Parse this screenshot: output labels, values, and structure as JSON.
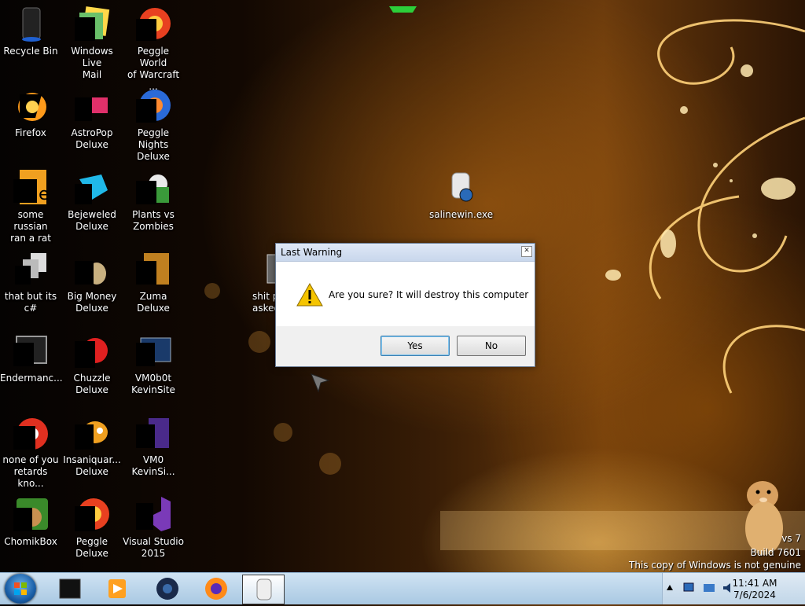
{
  "desktop": {
    "icons": [
      {
        "label": "Recycle Bin",
        "icon": "recycle-bin-icon"
      },
      {
        "label": "Windows Live\nMail",
        "icon": "mail-icon"
      },
      {
        "label": "Peggle World\nof Warcraft ...",
        "icon": "peggle-icon"
      },
      {
        "label": "Firefox",
        "icon": "firefox-icon"
      },
      {
        "label": "AstroPop\nDeluxe",
        "icon": "astropop-icon"
      },
      {
        "label": "Peggle Nights\nDeluxe",
        "icon": "peggle-nights-icon"
      },
      {
        "label": "some russian\nran a rat",
        "icon": "file-icon"
      },
      {
        "label": "Bejeweled\nDeluxe",
        "icon": "bejeweled-icon"
      },
      {
        "label": "Plants vs\nZombies",
        "icon": "plants-vs-zombies-icon"
      },
      {
        "label": "that but its c#",
        "icon": "shortcut-icon"
      },
      {
        "label": "Big Money\nDeluxe",
        "icon": "big-money-icon"
      },
      {
        "label": "Zuma Deluxe",
        "icon": "zuma-icon"
      },
      {
        "label": "Endermanc...",
        "icon": "monitor-icon"
      },
      {
        "label": "Chuzzle\nDeluxe",
        "icon": "chuzzle-icon"
      },
      {
        "label": "VM0b0t\nKevinSite",
        "icon": "vm-icon"
      },
      {
        "label": "none of you\nretards kno...",
        "icon": "chrome-icon"
      },
      {
        "label": "Insaniquar...\nDeluxe",
        "icon": "insaniquarium-icon"
      },
      {
        "label": "VM0\nKevinSi...",
        "icon": "vm-file-icon"
      },
      {
        "label": "ChomikBox",
        "icon": "chomikbox-icon"
      },
      {
        "label": "Peggle Deluxe",
        "icon": "peggle-deluxe-icon"
      },
      {
        "label": "Visual Studio\n2015",
        "icon": "visual-studio-icon"
      }
    ],
    "saline": {
      "label": "salinewin.exe",
      "icon": "executable-icon"
    },
    "partial_icon": {
      "label": "shit p\nasked",
      "icon": "folder-icon"
    }
  },
  "dialog": {
    "title": "Last Warning",
    "message": "Are you sure? It will destroy this computer",
    "yes_label": "Yes",
    "no_label": "No",
    "icon": "warning-icon"
  },
  "watermark": {
    "line1": "vs 7",
    "line2": "Build 7601",
    "line3": "This copy of Windows is not genuine"
  },
  "taskbar": {
    "pinned": [
      "cmd-icon",
      "media-player-icon",
      "steam-icon",
      "firefox-icon",
      "salinewin-icon"
    ],
    "time": "11:41 AM",
    "date": "7/6/2024"
  },
  "colors": {
    "accent": "#1a5fa8",
    "dialog_bg": "#f0f0f0",
    "taskbar": "#a9c8e2"
  }
}
